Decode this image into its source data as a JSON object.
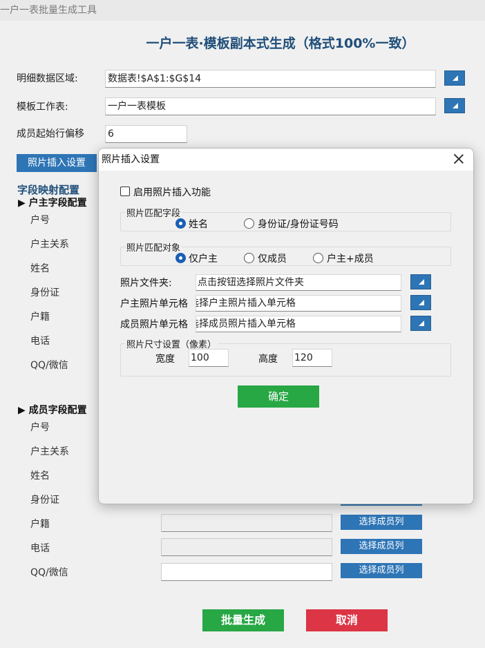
{
  "window": {
    "title": "一户一表批量生成工具"
  },
  "header": {
    "title": "一户一表·模板副本式生成（格式100%一致）"
  },
  "form": {
    "detail_range_label": "明细数据区域:",
    "detail_range_value": "数据表!$A$1:$G$14",
    "template_sheet_label": "模板工作表:",
    "template_sheet_value": "一户一表模板",
    "member_offset_label": "成员起始行偏移",
    "member_offset_value": "6",
    "photo_settings_button": "照片插入设置"
  },
  "mapping": {
    "title": "字段映射配置",
    "owner_section": "户主字段配置",
    "owner_fields": [
      "户号",
      "户主关系",
      "姓名",
      "身份证",
      "户籍",
      "电话",
      "QQ/微信"
    ],
    "member_section": "成员字段配置",
    "member_fields": [
      "户号",
      "户主关系",
      "姓名",
      "身份证",
      "户籍",
      "电话",
      "QQ/微信"
    ],
    "select_member_col": "选择成员列"
  },
  "actions": {
    "generate": "批量生成",
    "cancel": "取消"
  },
  "dialog": {
    "title": "照片插入设置",
    "enable_label": "启用照片插入功能",
    "match_field_legend": "照片匹配字段",
    "match_field_options": [
      "姓名",
      "身份证/身份证号码"
    ],
    "match_target_legend": "照片匹配对象",
    "match_target_options": [
      "仅户主",
      "仅成员",
      "户主+成员"
    ],
    "folder_label": "照片文件夹:",
    "folder_value": "点击按钮选择照片文件夹",
    "owner_cell_label": "户主照片单元格",
    "owner_cell_value": "选择户主照片插入单元格",
    "member_cell_label": "成员照片单元格",
    "member_cell_value": "选择成员照片插入单元格",
    "size_legend": "照片尺寸设置（像素）",
    "width_label": "宽度",
    "width_value": "100",
    "height_label": "高度",
    "height_value": "120",
    "ok_button": "确定"
  },
  "colors": {
    "primary": "#2e75b6",
    "title": "#1f4e79",
    "ok": "#28a745",
    "cancel": "#dc3545"
  }
}
